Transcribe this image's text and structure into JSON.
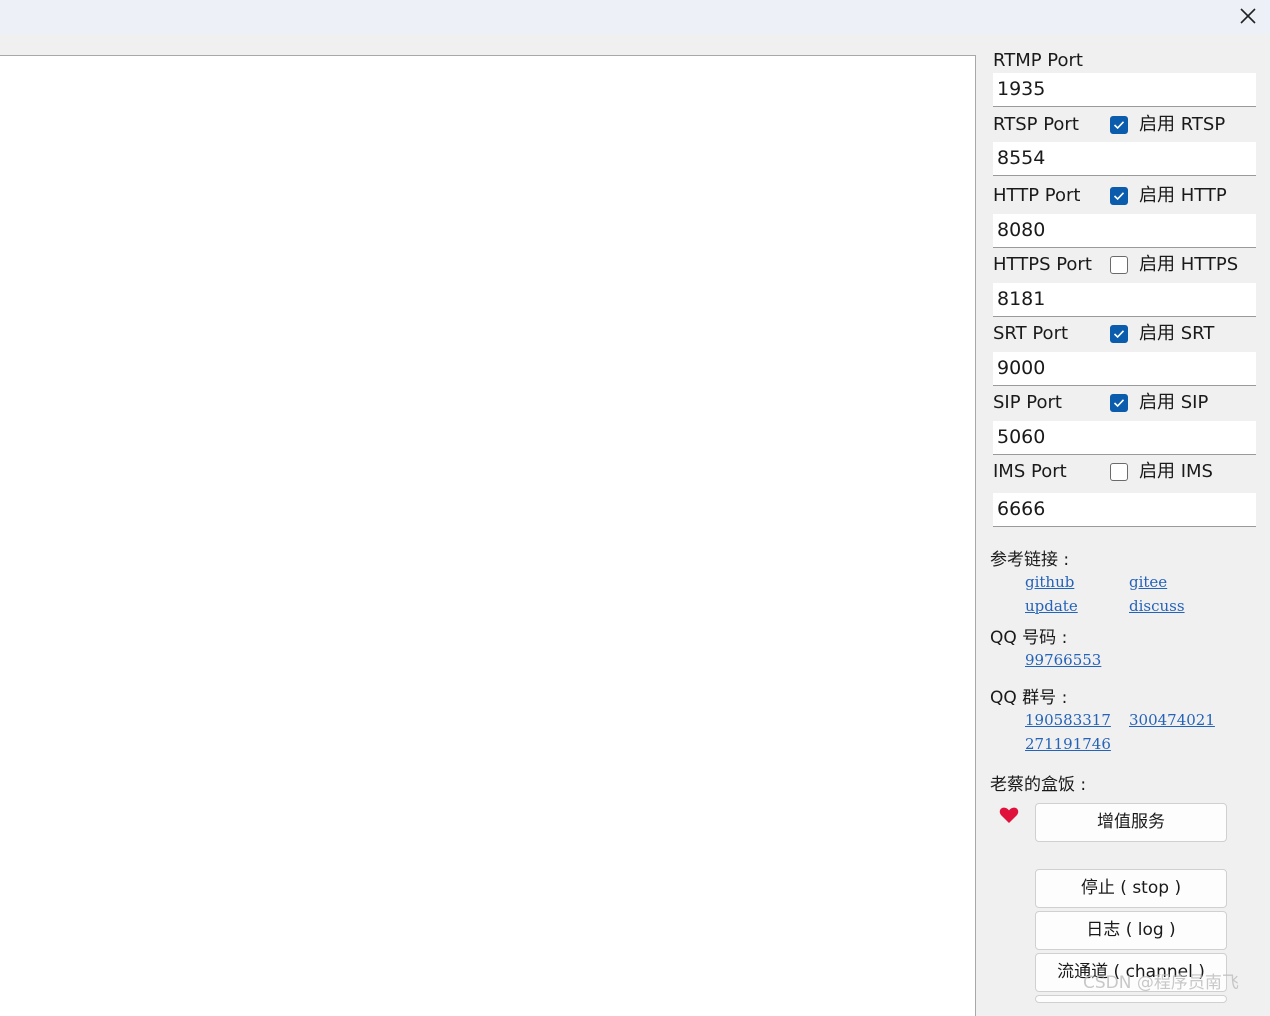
{
  "window": {
    "close_icon": "close-icon"
  },
  "ports": [
    {
      "label": "RTMP Port",
      "value": "1935"
    },
    {
      "label": "RTSP Port",
      "value": "8554",
      "toggle_label": "启用 RTSP",
      "enabled": true
    },
    {
      "label": "HTTP Port",
      "value": "8080",
      "toggle_label": "启用 HTTP",
      "enabled": true
    },
    {
      "label": "HTTPS Port",
      "value": "8181",
      "toggle_label": "启用 HTTPS",
      "enabled": false
    },
    {
      "label": "SRT Port",
      "value": "9000",
      "toggle_label": "启用 SRT",
      "enabled": true
    },
    {
      "label": "SIP Port",
      "value": "5060",
      "toggle_label": "启用 SIP",
      "enabled": true
    },
    {
      "label": "IMS Port",
      "value": "6666",
      "toggle_label": "启用 IMS",
      "enabled": false
    }
  ],
  "references": {
    "title": "参考链接 :",
    "links": [
      "github",
      "gitee",
      "update",
      "discuss"
    ]
  },
  "qq_number": {
    "title": "QQ 号码 :",
    "values": [
      "99766553"
    ]
  },
  "qq_group": {
    "title": "QQ 群号 :",
    "values": [
      "190583317",
      "300474021",
      "271191746"
    ]
  },
  "donate": {
    "title": "老蔡的盒饭 :",
    "heart_icon": "heart-icon",
    "heart_color": "#e0113a",
    "service_button": "增值服务"
  },
  "actions": {
    "stop": "停止 ( stop )",
    "log": "日志 ( log )",
    "channel": "流通道 ( channel )"
  },
  "colors": {
    "accent": "#0b5cad",
    "link": "#2563b8"
  },
  "watermark": "CSDN @程序员南飞"
}
